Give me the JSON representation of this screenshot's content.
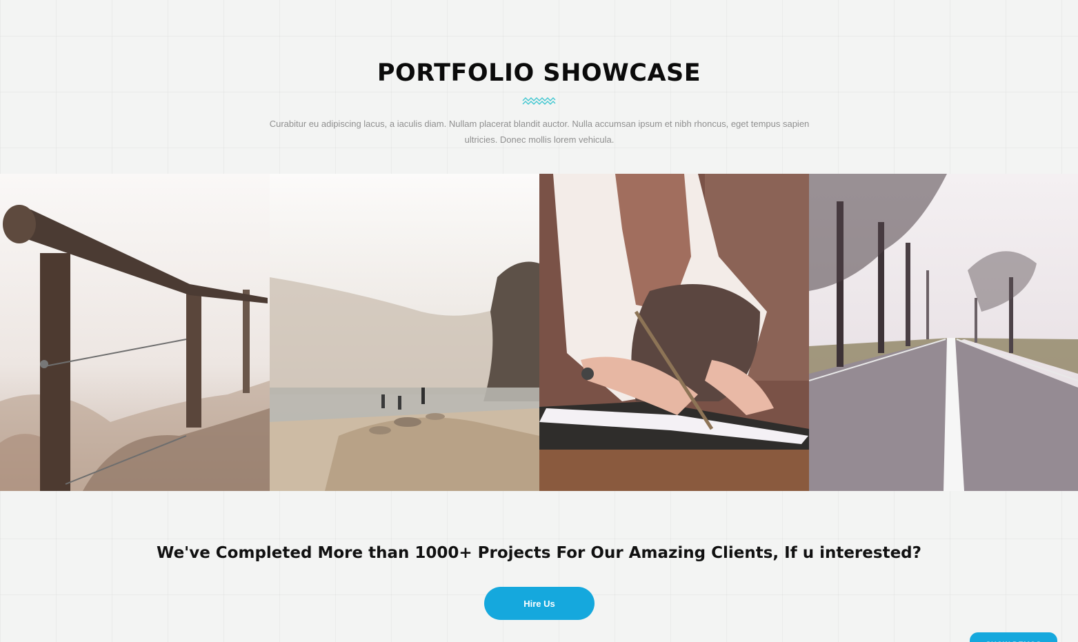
{
  "section": {
    "title": "PORTFOLIO SHOWCASE",
    "description": "Curabitur eu adipiscing lacus, a iaculis diam. Nullam placerat blandit auctor. Nulla accumsan ipsum et nibh rhoncus, eget tempus sapien ultricies. Donec mollis lorem vehicula.",
    "divider_icon": "zigzag-wave-icon",
    "accent_color": "#3fc6d0"
  },
  "gallery": {
    "items": [
      {
        "icon": "wooden-fence-photo"
      },
      {
        "icon": "misty-lake-photo"
      },
      {
        "icon": "woman-writing-photo"
      },
      {
        "icon": "tree-lined-road-photo"
      }
    ]
  },
  "cta": {
    "headline": "We've Completed More than 1000+ Projects For Our Amazing Clients, If u interested?",
    "button_label": "Hire Us",
    "button_color": "#15a8dd"
  },
  "floating": {
    "show_demos_label": "SHOW DEMOS"
  }
}
